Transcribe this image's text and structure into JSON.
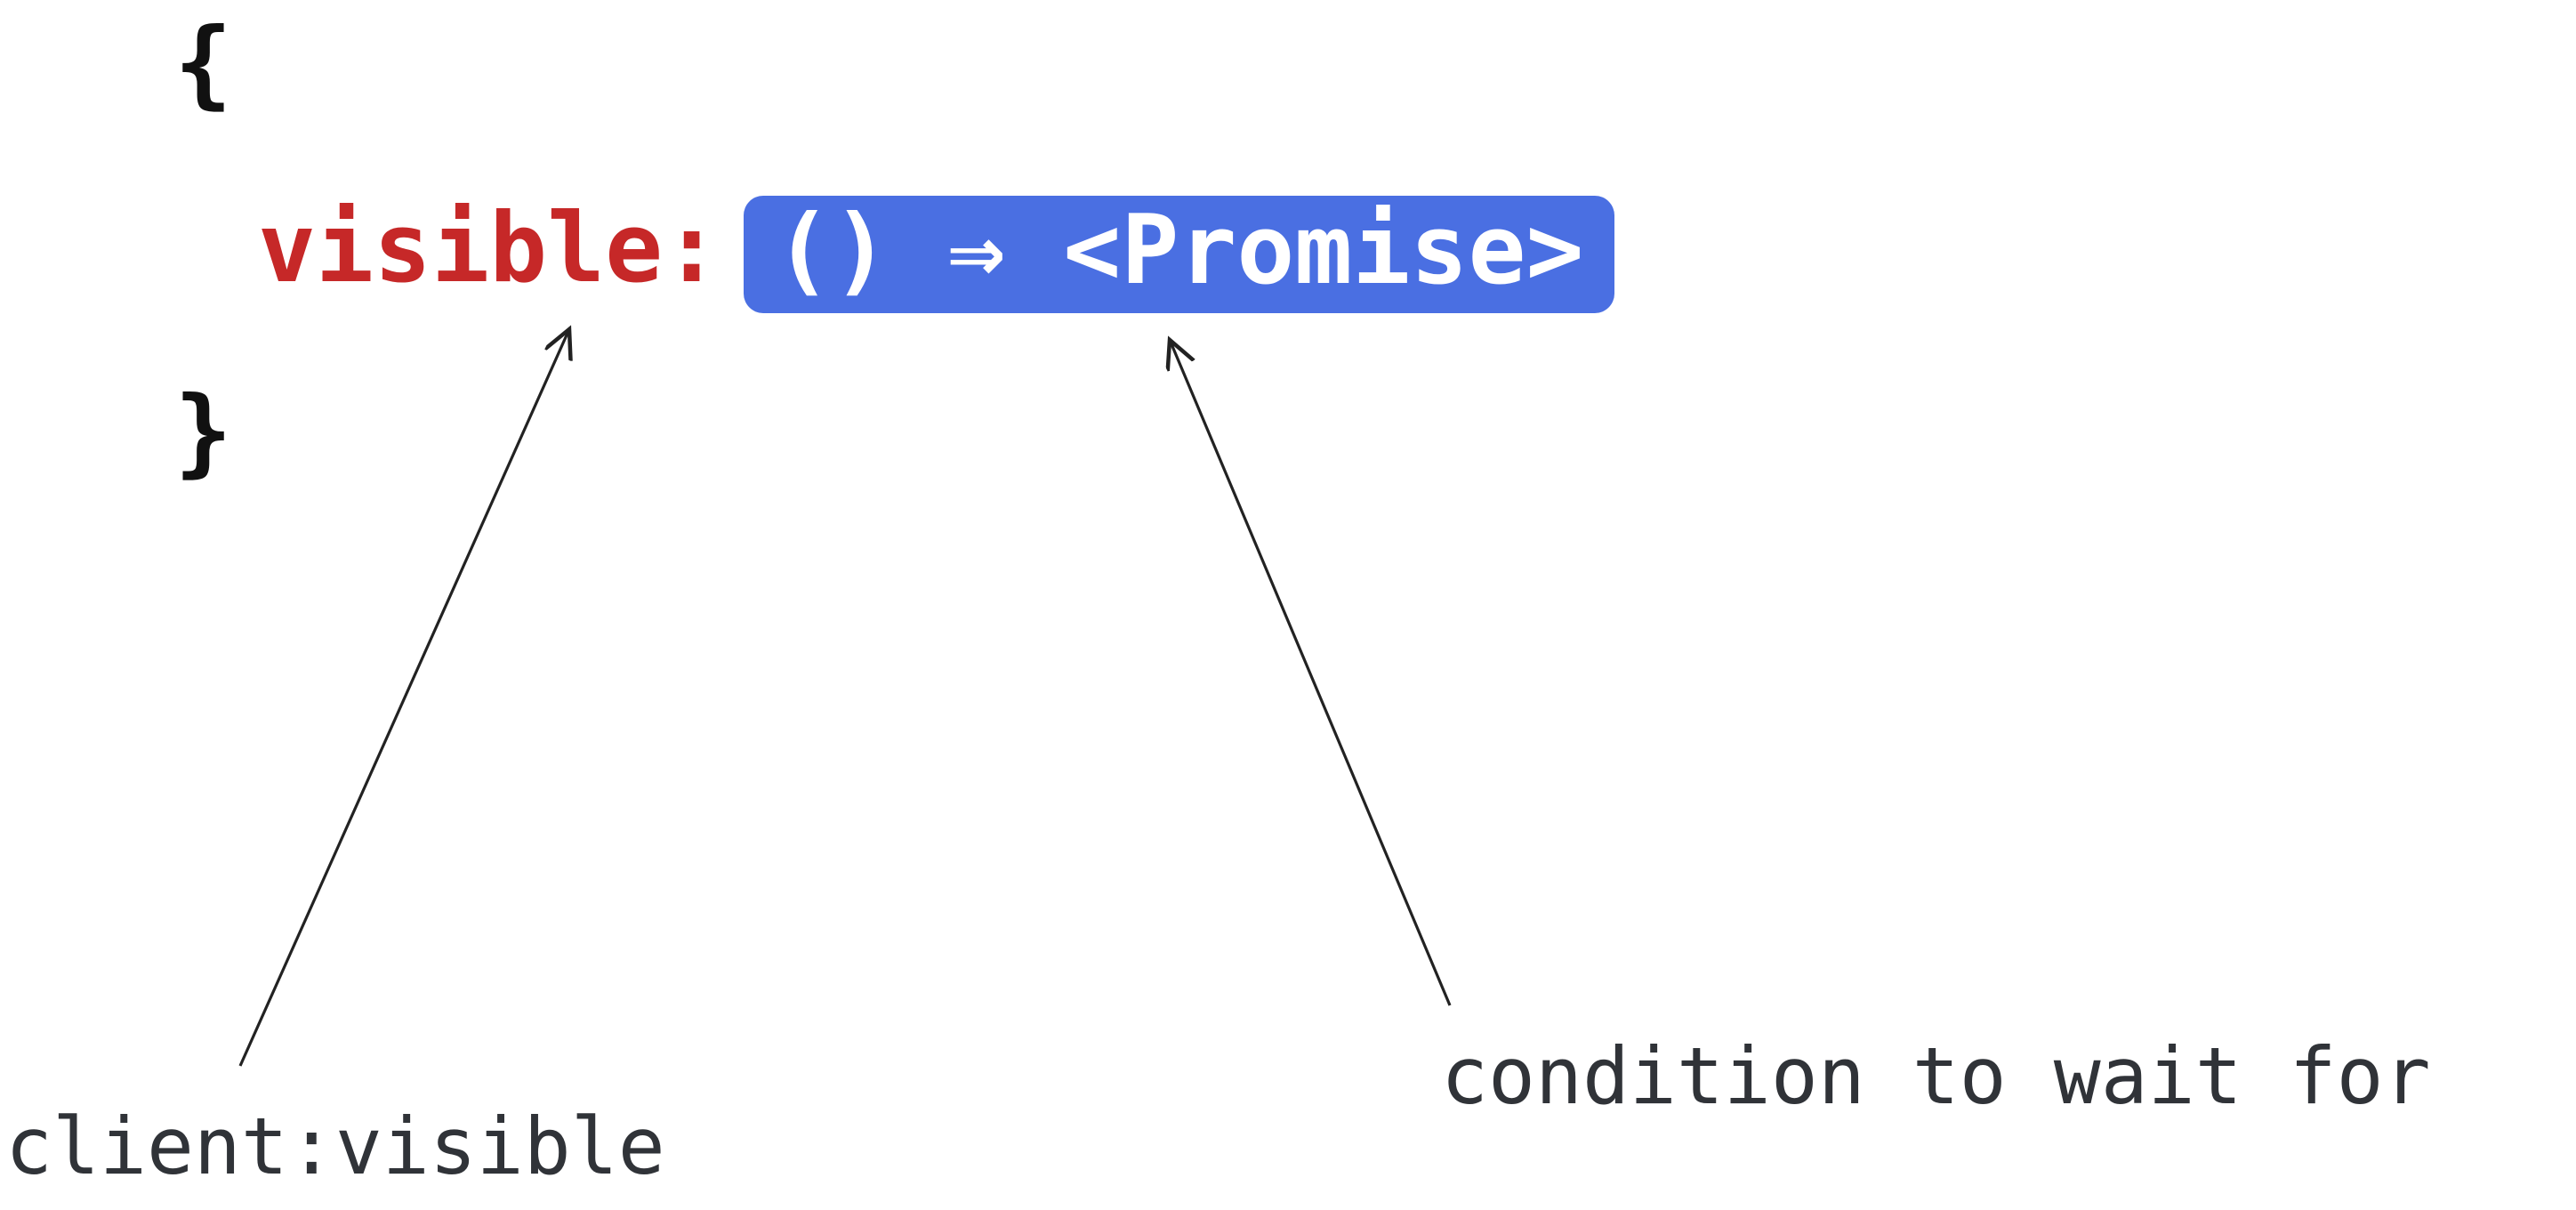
{
  "code": {
    "brace_open": "{",
    "key": "visible",
    "colon": ":",
    "badge": "() ⇒ <Promise>",
    "brace_close": "}"
  },
  "annotations": {
    "left_label": "client:visible",
    "right_label": "condition to wait for"
  }
}
